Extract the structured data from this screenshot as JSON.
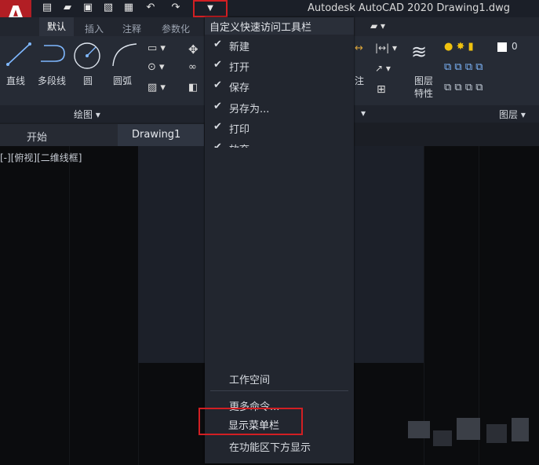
{
  "titlebar": {
    "app_title": "Autodesk AutoCAD 2020    Drawing1.dwg"
  },
  "logo": {
    "letter": "A"
  },
  "ribbon_tabs": [
    "默认",
    "插入",
    "注释",
    "参数化"
  ],
  "ribbon": {
    "draw_tools": [
      "直线",
      "多段线",
      "圆",
      "圆弧"
    ],
    "draw_panel_title": "绘图 ▾",
    "annotation_label": "注",
    "layer_properties": [
      "图层",
      "特性"
    ],
    "layer_panel_title": "图层 ▾",
    "layer_number": "0"
  },
  "doc_tabs": {
    "start": "开始",
    "drawing": "Drawing1"
  },
  "viewport_label": "[-][俯视][二维线框]",
  "menu": {
    "header": "自定义快速访问工具栏",
    "checked_items": [
      "新建",
      "打开",
      "保存",
      "另存为...",
      "打印",
      "放弃"
    ],
    "bottom_items": [
      "工作空间",
      "更多命令...",
      "显示菜单栏",
      "在功能区下方显示"
    ]
  },
  "colors": {
    "accent_red": "#d21f23",
    "logo_red": "#b21e24",
    "menu_bg": "#22262f"
  },
  "icons": {
    "qat": [
      "new-file-icon",
      "open-folder-icon",
      "save-icon",
      "save-as-icon",
      "print-icon",
      "undo-icon",
      "redo-icon"
    ],
    "check": "checkmark-icon"
  }
}
